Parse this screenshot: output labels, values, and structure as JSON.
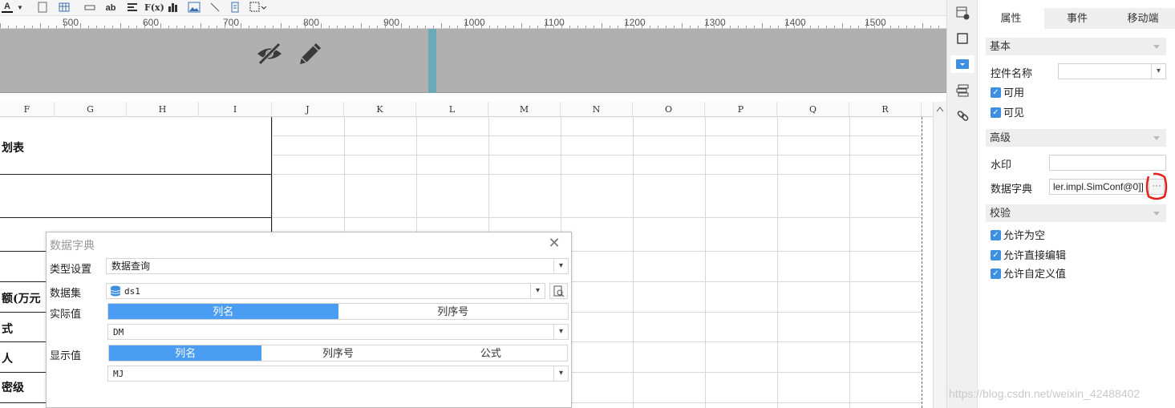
{
  "toolbar": {
    "items": [
      "A",
      "ab",
      "F(x)"
    ]
  },
  "ruler": {
    "labels": [
      "500",
      "600",
      "700",
      "800",
      "900",
      "1000",
      "1100",
      "1200",
      "1300",
      "1400",
      "1500"
    ]
  },
  "columns": [
    "F",
    "G",
    "H",
    "I",
    "J",
    "K",
    "L",
    "M",
    "N",
    "O",
    "P",
    "Q",
    "R"
  ],
  "cells": {
    "row1": "划表",
    "row6": "额(万元",
    "row7": "式",
    "row8": "人",
    "row9": "密级"
  },
  "panel": {
    "tabs": [
      "属性",
      "事件",
      "移动端"
    ],
    "sections": {
      "basic": "基本",
      "advanced": "高级",
      "validation": "校验"
    },
    "control_name_label": "控件名称",
    "control_name_value": "",
    "enabled_label": "可用",
    "visible_label": "可见",
    "watermark_label": "水印",
    "watermark_value": "",
    "dictionary_label": "数据字典",
    "dictionary_value": "ler.impl.SimConf@0]]",
    "dictionary_button": "···",
    "allow_empty_label": "允许为空",
    "allow_direct_edit_label": "允许直接编辑",
    "allow_custom_label": "允许自定义值"
  },
  "dialog": {
    "title": "数据字典",
    "type_label": "类型设置",
    "type_value": "数据查询",
    "dataset_label": "数据集",
    "dataset_value": "ds1",
    "actual_label": "实际值",
    "actual_options": [
      "列名",
      "列序号"
    ],
    "actual_field": "DM",
    "display_label": "显示值",
    "display_options": [
      "列名",
      "列序号",
      "公式"
    ],
    "display_field": "MJ"
  },
  "watermark": "https://blog.csdn.net/weixin_42488402",
  "colors": {
    "accent": "#4a9df2",
    "annotation": "#e8201a",
    "band": "#b0b0b0"
  }
}
